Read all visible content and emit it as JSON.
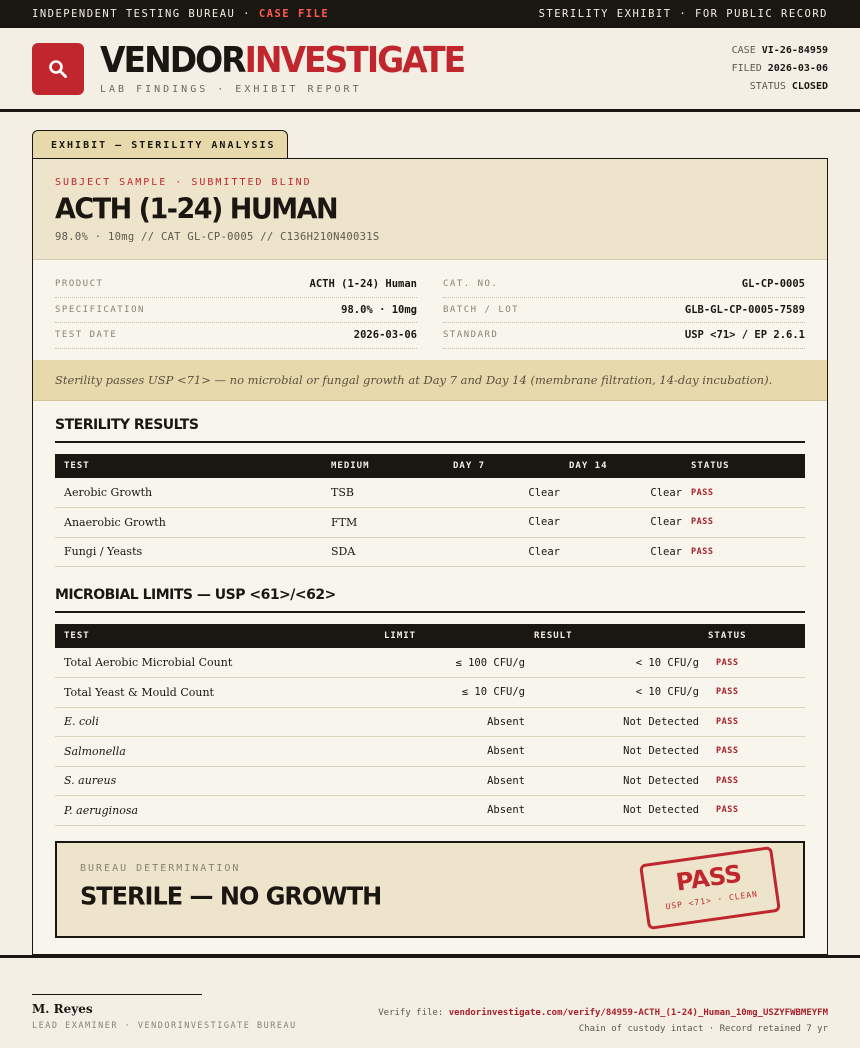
{
  "topbar": {
    "left_prefix": "INDEPENDENT TESTING BUREAU ·",
    "left_highlight": "CASE FILE",
    "right": "STERILITY EXHIBIT · FOR PUBLIC RECORD"
  },
  "header": {
    "logo_icon": "magnifier-icon",
    "brand_part1": "VENDOR",
    "brand_part2": "INVESTIGATE",
    "subtitle": "LAB FINDINGS · EXHIBIT REPORT",
    "case_label": "CASE",
    "case_value": "VI-26-84959",
    "filed_label": "FILED",
    "filed_value": "2026-03-06",
    "status_label": "STATUS",
    "status_value": "CLOSED"
  },
  "exhibit": {
    "tab_label": "EXHIBIT — STERILITY ANALYSIS",
    "subject_label": "SUBJECT SAMPLE · SUBMITTED BLIND",
    "subject_title": "ACTH (1-24) HUMAN",
    "subject_spec": "98.0% · 10mg  //  CAT GL-CP-0005  //  C136H210N40031S",
    "info_left": [
      {
        "key": "PRODUCT",
        "value": "ACTH (1-24) Human"
      },
      {
        "key": "SPECIFICATION",
        "value": "98.0% · 10mg"
      },
      {
        "key": "TEST DATE",
        "value": "2026-03-06"
      }
    ],
    "info_right": [
      {
        "key": "CAT. NO.",
        "value": "GL-CP-0005"
      },
      {
        "key": "BATCH / LOT",
        "value": "GLB-GL-CP-0005-7589"
      },
      {
        "key": "STANDARD",
        "value": "USP <71> / EP 2.6.1"
      }
    ],
    "note": "Sterility passes USP <71> — no microbial or fungal growth at Day 7 and Day 14 (membrane filtration, 14-day incubation)."
  },
  "sterility": {
    "title": "STERILITY RESULTS",
    "headers": [
      "TEST",
      "MEDIUM",
      "DAY 7",
      "DAY 14",
      "STATUS"
    ],
    "rows": [
      {
        "test": "Aerobic Growth",
        "medium": "TSB",
        "day7": "Clear",
        "day14": "Clear",
        "status": "PASS"
      },
      {
        "test": "Anaerobic Growth",
        "medium": "FTM",
        "day7": "Clear",
        "day14": "Clear",
        "status": "PASS"
      },
      {
        "test": "Fungi / Yeasts",
        "medium": "SDA",
        "day7": "Clear",
        "day14": "Clear",
        "status": "PASS"
      }
    ]
  },
  "microbial": {
    "title": "MICROBIAL LIMITS — USP <61>/<62>",
    "headers": [
      "TEST",
      "LIMIT",
      "RESULT",
      "STATUS"
    ],
    "rows": [
      {
        "test": "Total Aerobic Microbial Count",
        "limit": "≤ 100 CFU/g",
        "result": "< 10 CFU/g",
        "status": "PASS"
      },
      {
        "test": "Total Yeast & Mould Count",
        "limit": "≤ 10 CFU/g",
        "result": "< 10 CFU/g",
        "status": "PASS"
      },
      {
        "test": "E. coli",
        "limit": "Absent",
        "result": "Not Detected",
        "status": "PASS"
      },
      {
        "test": "Salmonella",
        "limit": "Absent",
        "result": "Not Detected",
        "status": "PASS"
      },
      {
        "test": "S. aureus",
        "limit": "Absent",
        "result": "Not Detected",
        "status": "PASS"
      },
      {
        "test": "P. aeruginosa",
        "limit": "Absent",
        "result": "Not Detected",
        "status": "PASS"
      }
    ]
  },
  "determination": {
    "label": "BUREAU DETERMINATION",
    "value": "STERILE — NO GROWTH",
    "stamp_main": "PASS",
    "stamp_sub": "USP <71> · CLEAN"
  },
  "footer": {
    "signer_name": "M. Reyes",
    "signer_role": "LEAD EXAMINER · VENDORINVESTIGATE BUREAU",
    "verify_label": "Verify file:",
    "verify_link": "vendorinvestigate.com/verify/84959-ACTH_(1-24)_Human_10mg_USZYFWBMEYFM",
    "custody": "Chain of custody intact · Record retained 7 yr"
  },
  "colors": {
    "accent": "#c0262d",
    "ink": "#1a1712",
    "paper": "#f3efe4",
    "tab": "#e8d9ad"
  }
}
